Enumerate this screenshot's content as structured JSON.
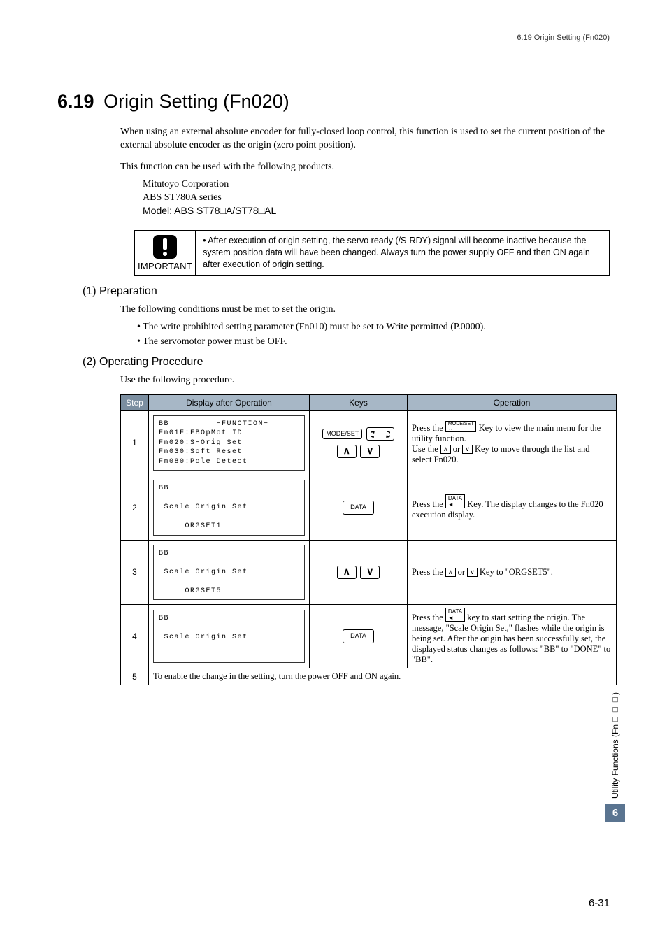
{
  "header": {
    "right": "6.19  Origin Setting (Fn020)"
  },
  "title": {
    "num": "6.19",
    "text": "Origin Setting (Fn020)"
  },
  "intro": [
    "When using an external absolute encoder for fully-closed loop control, this function is used to set the current position of the external absolute encoder as the origin (zero point position).",
    "This function can be used with the following products."
  ],
  "product_lines": [
    "Mitutoyo Corporation",
    "ABS ST780A series",
    "Model: ABS ST78□A/ST78□AL"
  ],
  "important": {
    "label": "IMPORTANT",
    "text": "• After execution of origin setting, the servo ready (/S-RDY) signal will become inactive because the system position data will have been changed. Always turn the power supply OFF and then ON again after execution of origin setting."
  },
  "sub1": {
    "h": "(1)  Preparation",
    "p": "The following conditions must be met to set the origin.",
    "bullets": [
      "• The write prohibited setting parameter (Fn010) must be set to Write permitted (P.0000).",
      "• The servomotor power must be OFF."
    ]
  },
  "sub2": {
    "h": "(2)  Operating Procedure",
    "p": "Use the following procedure."
  },
  "table": {
    "headers": {
      "step": "Step",
      "disp": "Display after Operation",
      "keys": "Keys",
      "op": "Operation"
    },
    "rows": [
      {
        "step": "1",
        "lcd": "BB         −FUNCTION−\nFn01F:FBOpMot ID\nFn020:S−Orig Set\nFn030:Soft Reset\nFn080:Pole Detect",
        "lcd_highlight_line": 2,
        "keys": [
          "MODE/SET",
          "SCROLL",
          "UP",
          "DOWN"
        ],
        "op_pre": "Press the ",
        "op_key1": "MODE/SET",
        "op_mid1": " Key to view the main menu for the utility function.",
        "op_line2_pre": "Use the ",
        "op_key_up": "∧",
        "op_or": " or ",
        "op_key_dn": "∨",
        "op_line2_post": " Key to move through the list and select Fn020."
      },
      {
        "step": "2",
        "lcd": "BB\n\n Scale Origin Set\n\n     ORGSET1",
        "keys": [
          "DATA"
        ],
        "op_pre": "Press the ",
        "op_key1": "DATA",
        "op_post": " Key. The display changes to the Fn020 execution display."
      },
      {
        "step": "3",
        "lcd": "BB\n\n Scale Origin Set\n\n     ORGSET5",
        "keys": [
          "UP",
          "DOWN"
        ],
        "op_pre": "Press the ",
        "op_key_up": "∧",
        "op_or": " or ",
        "op_key_dn": "∨",
        "op_post": " Key to \"ORGSET5\"."
      },
      {
        "step": "4",
        "lcd": "BB\n\n Scale Origin Set",
        "keys": [
          "DATA"
        ],
        "op_pre": "Press the ",
        "op_key1": "DATA",
        "op_post": " key to start setting the origin. The message, \"Scale Origin Set,\" flashes while the origin is being set. After the origin has been successfully set, the displayed status changes as follows: \"BB\" to \"DONE\" to \"BB\"."
      },
      {
        "step": "5",
        "full": "To enable the change in the setting, turn the power OFF and ON again."
      }
    ]
  },
  "side": {
    "text": "Utility Functions (Fn□□□)",
    "num": "6"
  },
  "pagenum": "6-31"
}
